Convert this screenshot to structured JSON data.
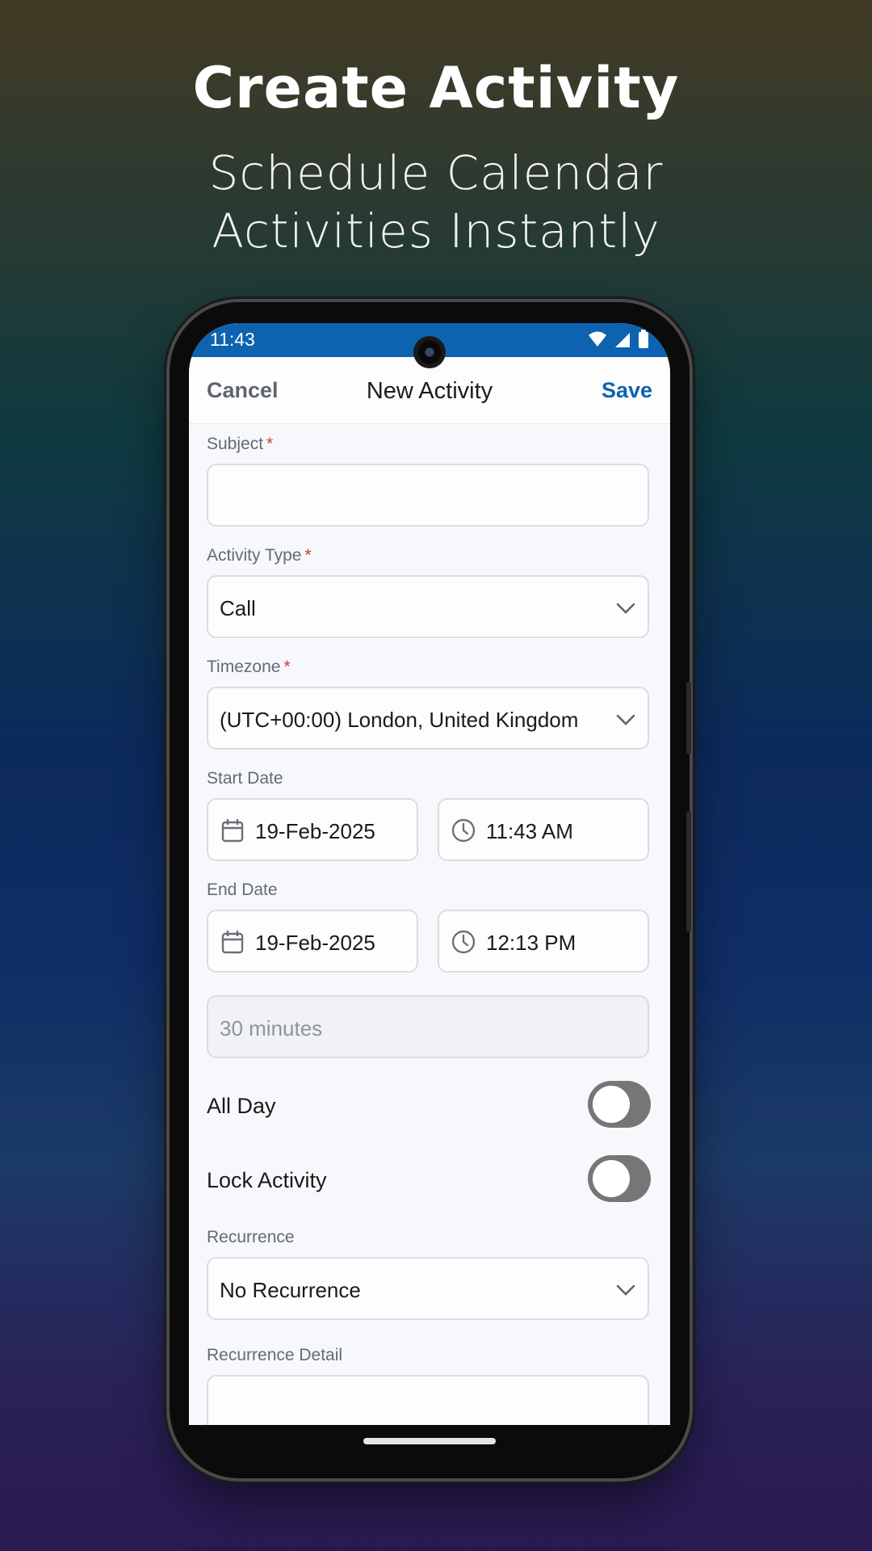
{
  "hero": {
    "title": "Create Activity",
    "subtitle": "Schedule Calendar Activities Instantly"
  },
  "status_bar": {
    "time": "11:43",
    "icons": [
      "wifi-icon",
      "signal-icon",
      "battery-icon"
    ]
  },
  "nav": {
    "cancel_label": "Cancel",
    "title": "New Activity",
    "save_label": "Save"
  },
  "form": {
    "subject": {
      "label": "Subject",
      "required_mark": "*",
      "value": ""
    },
    "activity_type": {
      "label": "Activity Type",
      "required_mark": "*",
      "value": "Call"
    },
    "timezone": {
      "label": "Timezone",
      "required_mark": "*",
      "value": "(UTC+00:00) London, United Kingdom"
    },
    "start": {
      "label": "Start Date",
      "date": "19-Feb-2025",
      "time": "11:43 AM"
    },
    "end": {
      "label": "End Date",
      "date": "19-Feb-2025",
      "time": "12:13 PM"
    },
    "duration": {
      "value": "30 minutes"
    },
    "all_day": {
      "label": "All Day",
      "enabled": false
    },
    "lock_activity": {
      "label": "Lock Activity",
      "enabled": false
    },
    "recurrence": {
      "label": "Recurrence",
      "value": "No Recurrence"
    },
    "recurrence_detail": {
      "label": "Recurrence Detail",
      "value": ""
    }
  },
  "colors": {
    "accent": "#0d63b0",
    "required": "#d23b3b",
    "toggle_off": "#767676"
  }
}
